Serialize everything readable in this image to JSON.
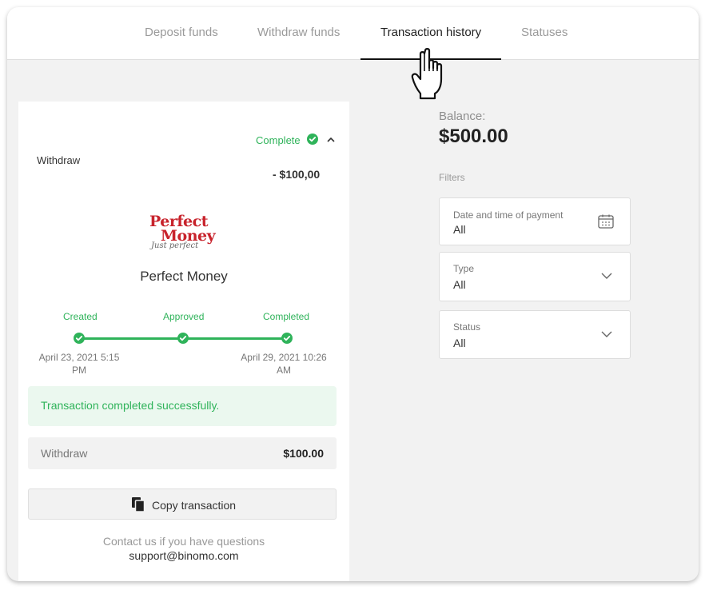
{
  "tabs": [
    {
      "label": "Deposit funds"
    },
    {
      "label": "Withdraw funds"
    },
    {
      "label": "Transaction history"
    },
    {
      "label": "Statuses"
    }
  ],
  "transaction": {
    "status": "Complete",
    "type": "Withdraw",
    "amount": "- $100,00",
    "method_logo": {
      "line1": "Perfect",
      "line2": "Money",
      "tagline": "Just perfect"
    },
    "method_name": "Perfect Money",
    "steps": [
      {
        "label": "Created",
        "date": "April 23, 2021 5:15 PM"
      },
      {
        "label": "Approved",
        "date": ""
      },
      {
        "label": "Completed",
        "date": "April 29, 2021 10:26 AM"
      }
    ],
    "success_message": "Transaction completed successfully.",
    "summary_label": "Withdraw",
    "summary_value": "$100.00",
    "copy_button": "Copy transaction",
    "contact_text": "Contact us if you have questions",
    "support_email": "support@binomo.com"
  },
  "balance": {
    "label": "Balance:",
    "value": "$500.00"
  },
  "filters": {
    "title": "Filters",
    "date": {
      "label": "Date and time of payment",
      "value": "All"
    },
    "type": {
      "label": "Type",
      "value": "All"
    },
    "status": {
      "label": "Status",
      "value": "All"
    }
  },
  "colors": {
    "accent_green": "#2fb35a",
    "logo_red": "#c8232c",
    "background": "#f2f2f2"
  },
  "icons": [
    "check-circle-icon",
    "chevron-up-icon",
    "copy-icon",
    "calendar-icon",
    "chevron-down-icon",
    "hand-pointer-cursor"
  ]
}
